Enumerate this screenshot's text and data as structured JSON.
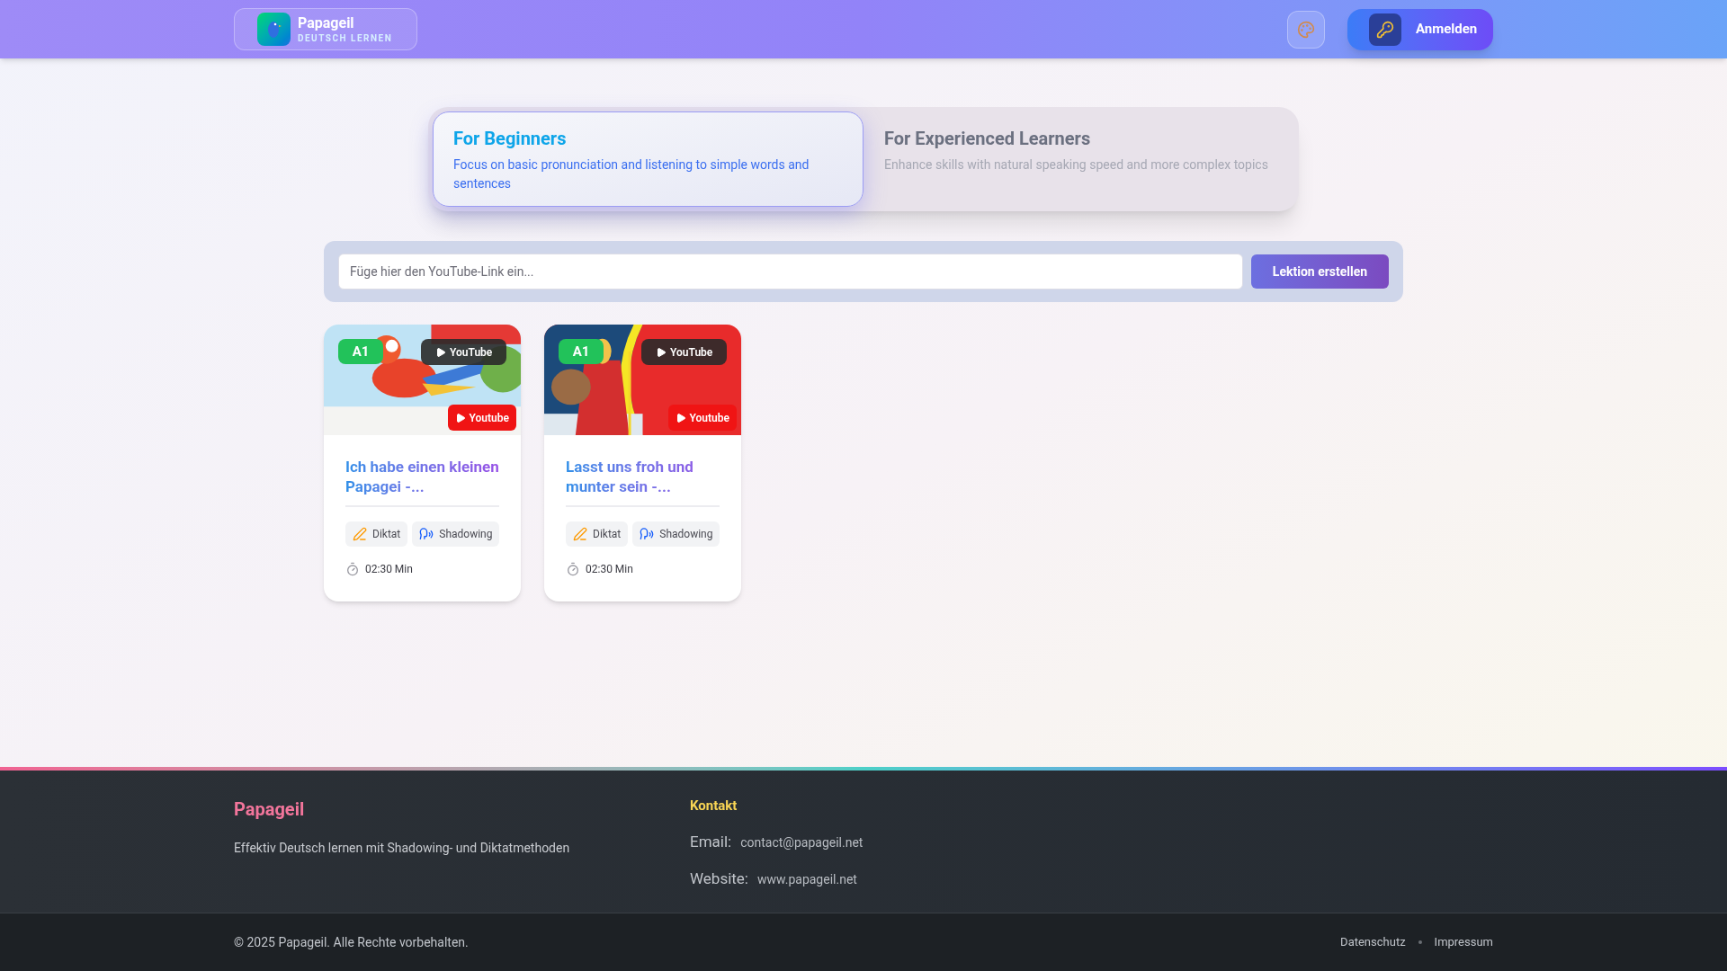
{
  "header": {
    "brand": "Papageil",
    "tagline": "DEUTSCH LERNEN",
    "login": "Anmelden"
  },
  "tabs": [
    {
      "title": "For Beginners",
      "description": "Focus on basic pronunciation and listening to simple words and sentences",
      "selected": true
    },
    {
      "title": "For Experienced Learners",
      "description": "Enhance skills with natural speaking speed and more complex topics",
      "selected": false
    }
  ],
  "search": {
    "placeholder": "Füge hier den YouTube-Link ein...",
    "button": "Lektion erstellen"
  },
  "lessons": [
    {
      "level": "A1",
      "source": "YouTube",
      "channel_badge": "Youtube",
      "title": "Ich habe einen kleinen Papagei -...",
      "tags": [
        {
          "kind": "dictation",
          "label": "Diktat"
        },
        {
          "kind": "shadowing",
          "label": "Shadowing"
        }
      ],
      "duration": "02:30 Min",
      "kind": "picture"
    },
    {
      "level": "A1",
      "source": "YouTube",
      "channel_badge": "Youtube",
      "title": "Lasst uns froh und munter sein -...",
      "tags": [
        {
          "kind": "dictation",
          "label": "Diktat"
        },
        {
          "kind": "shadowing",
          "label": "Shadowing"
        }
      ],
      "duration": "02:30 Min",
      "kind": "picture"
    }
  ],
  "footer": {
    "brand": "Papageil",
    "tagline": "Effektiv Deutsch lernen mit Shadowing- und Diktatmethoden",
    "contact_title": "Kontakt",
    "contacts": [
      {
        "label": "Email:",
        "value": "contact@papageil.net"
      },
      {
        "label": "Website:",
        "value": "www.papageil.net"
      }
    ],
    "copyright": "© 2025 Papageil. Alle Rechte vorbehalten.",
    "links": [
      "Datenschutz",
      "Impressum"
    ]
  }
}
